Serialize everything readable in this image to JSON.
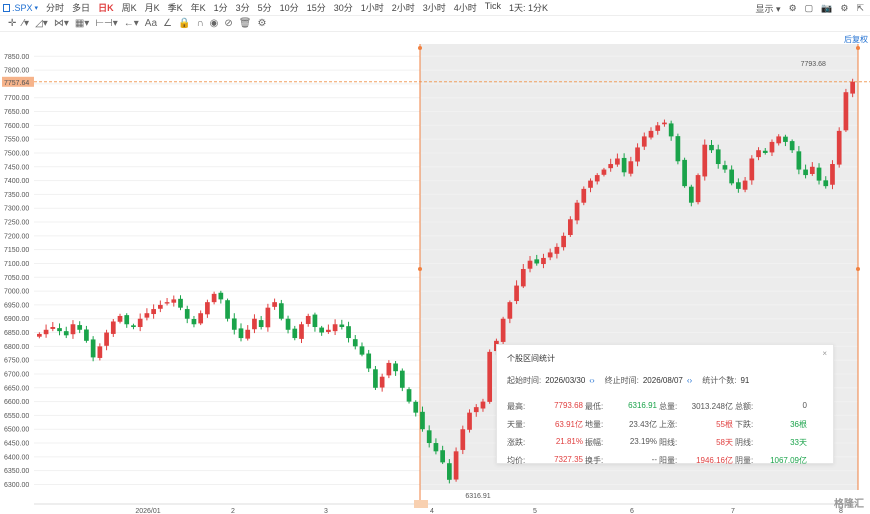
{
  "toolbar": {
    "symbol": ".SPX",
    "timeframes": [
      "分时",
      "多日",
      "日K",
      "周K",
      "月K",
      "季K",
      "年K",
      "1分",
      "3分",
      "5分",
      "10分",
      "15分",
      "30分",
      "1小时",
      "2小时",
      "3小时",
      "4小时",
      "Tick",
      "1天: 1分K"
    ],
    "active_timeframe": "日K",
    "right_label": "显示"
  },
  "adjust_label": "后复权",
  "price_axis": {
    "ticks": [
      "7850.00",
      "7800.00",
      "7750.00",
      "7700.00",
      "7650.00",
      "7600.00",
      "7550.00",
      "7500.00",
      "7450.00",
      "7400.00",
      "7350.00",
      "7300.00",
      "7250.00",
      "7200.00",
      "7150.00",
      "7100.00",
      "7050.00",
      "7000.00",
      "6950.00",
      "6900.00",
      "6850.00",
      "6800.00",
      "6750.00",
      "6700.00",
      "6650.00",
      "6600.00",
      "6550.00",
      "6500.00",
      "6450.00",
      "6400.00",
      "6350.00",
      "6300.00"
    ],
    "current_price": "7757.64"
  },
  "x_axis": {
    "ticks": [
      "2026/01",
      "2",
      "3",
      "4",
      "5",
      "6",
      "7",
      "8"
    ]
  },
  "annotations": {
    "high_label": "7793.68",
    "low_label": "6316.91"
  },
  "chart_data": {
    "type": "candlestick",
    "price_range": [
      6280,
      7880
    ],
    "up_color": "#e04040",
    "down_color": "#1aa34a",
    "closes": [
      6845,
      6860,
      6870,
      6855,
      6840,
      6880,
      6860,
      6820,
      6760,
      6800,
      6850,
      6890,
      6910,
      6880,
      6870,
      6900,
      6920,
      6935,
      6950,
      6960,
      6970,
      6940,
      6900,
      6880,
      6920,
      6960,
      6990,
      6970,
      6900,
      6860,
      6830,
      6860,
      6900,
      6870,
      6940,
      6960,
      6900,
      6860,
      6830,
      6880,
      6910,
      6870,
      6850,
      6860,
      6880,
      6870,
      6830,
      6800,
      6770,
      6720,
      6650,
      6690,
      6740,
      6710,
      6650,
      6600,
      6560,
      6500,
      6450,
      6420,
      6380,
      6316.91,
      6420,
      6500,
      6560,
      6580,
      6600,
      6780,
      6820,
      6900,
      6960,
      7020,
      7080,
      7110,
      7100,
      7120,
      7140,
      7160,
      7200,
      7260,
      7320,
      7370,
      7400,
      7420,
      7440,
      7460,
      7480,
      7430,
      7470,
      7520,
      7560,
      7580,
      7600,
      7610,
      7560,
      7470,
      7380,
      7320,
      7420,
      7530,
      7510,
      7460,
      7440,
      7390,
      7370,
      7400,
      7480,
      7510,
      7500,
      7540,
      7560,
      7540,
      7510,
      7440,
      7420,
      7450,
      7400,
      7380,
      7460,
      7580,
      7720,
      7757.64
    ]
  },
  "stats_panel": {
    "title": "个股区间统计",
    "start_label": "起始时间:",
    "start_value": "2026/03/30",
    "end_label": "终止时间:",
    "end_value": "2026/08/07",
    "count_label": "统计个数:",
    "count_value": "91",
    "rows": [
      [
        {
          "k": "最高:",
          "v": "7793.68",
          "c": "red"
        },
        {
          "k": "最低:",
          "v": "6316.91",
          "c": "green"
        },
        {
          "k": "总量:",
          "v": "3013.248亿",
          "c": ""
        },
        {
          "k": "总额:",
          "v": "0",
          "c": ""
        }
      ],
      [
        {
          "k": "天量:",
          "v": "63.91亿",
          "c": "red"
        },
        {
          "k": "地量:",
          "v": "23.43亿",
          "c": ""
        },
        {
          "k": "上涨:",
          "v": "55根",
          "c": "red"
        },
        {
          "k": "下跌:",
          "v": "36根",
          "c": "green"
        }
      ],
      [
        {
          "k": "涨跌:",
          "v": "21.81%",
          "c": "red"
        },
        {
          "k": "振幅:",
          "v": "23.19%",
          "c": ""
        },
        {
          "k": "阳线:",
          "v": "58天",
          "c": "red"
        },
        {
          "k": "阴线:",
          "v": "33天",
          "c": "green"
        }
      ],
      [
        {
          "k": "均价:",
          "v": "7327.35",
          "c": "red"
        },
        {
          "k": "换手:",
          "v": "--",
          "c": ""
        },
        {
          "k": "阳量:",
          "v": "1946.16亿",
          "c": "red"
        },
        {
          "k": "阴量:",
          "v": "1067.09亿",
          "c": "green"
        }
      ]
    ]
  },
  "watermark": "格隆汇"
}
